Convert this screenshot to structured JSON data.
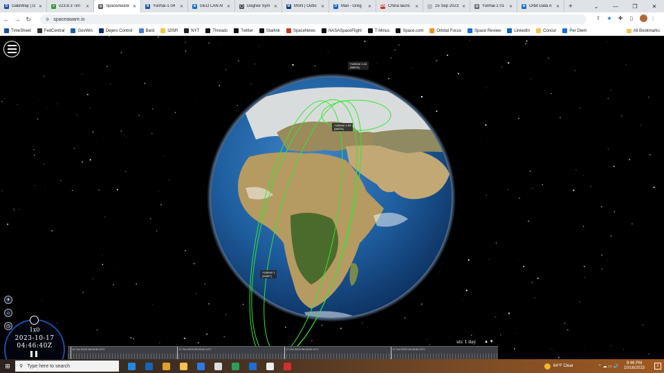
{
  "browser": {
    "tabs": [
      {
        "label": "GateWay | G",
        "color": "#1b4fa8",
        "glyph": "D"
      },
      {
        "label": "v23.8.3 Tim",
        "color": "#3a9b3a",
        "glyph": "≡"
      },
      {
        "label": "SpaceAware",
        "color": "#555555",
        "glyph": "◎",
        "active": true
      },
      {
        "label": "Yunhai-1 04",
        "color": "#2451a5",
        "glyph": "N"
      },
      {
        "label": "GEO LAN Al",
        "color": "#1a6fd0",
        "glyph": "★"
      },
      {
        "label": "Degree Sym",
        "color": "#4a4a4a",
        "glyph": "◯"
      },
      {
        "label": "MSN | Outlo",
        "color": "#0f3d7a",
        "glyph": "M"
      },
      {
        "label": "Mail - Greg",
        "color": "#0a64c8",
        "glyph": "O"
      },
      {
        "label": "China launc",
        "color": "#c0392b",
        "glyph": "SN"
      },
      {
        "label": "25 Sep 2023",
        "color": "#bbbbbb",
        "glyph": ""
      },
      {
        "label": "Yunhai-1 01",
        "color": "#666666",
        "glyph": "◎"
      },
      {
        "label": "Orbit Data A",
        "color": "#1a6fd0",
        "glyph": "★"
      }
    ],
    "url": "spaceaware.io",
    "bookmarks": [
      {
        "label": "TimeSheet",
        "color": "#1b4fa8"
      },
      {
        "label": "FedCentral",
        "color": "#333333"
      },
      {
        "label": "GovWin",
        "color": "#1f5fa9"
      },
      {
        "label": "Dejero Control",
        "color": "#102a6b"
      },
      {
        "label": "Bard",
        "color": "#4a7bd8"
      },
      {
        "label": "I2ISR",
        "color": "#f4c24d"
      },
      {
        "label": "NYT",
        "color": "#222222"
      },
      {
        "label": "Threads",
        "color": "#111111"
      },
      {
        "label": "Twitter",
        "color": "#111111"
      },
      {
        "label": "Starlink",
        "color": "#111111"
      },
      {
        "label": "SpaceNews",
        "color": "#c0392b"
      },
      {
        "label": "NASASpaceFlight",
        "color": "#111111"
      },
      {
        "label": "T-Minus",
        "color": "#111111"
      },
      {
        "label": "Space.com",
        "color": "#111111"
      },
      {
        "label": "Orbital Focus",
        "color": "#f28c28"
      },
      {
        "label": "Space Review",
        "color": "#1a6fd0"
      },
      {
        "label": "LinkedIn",
        "color": "#0a66c2"
      },
      {
        "label": "Concur",
        "color": "#f4c24d"
      },
      {
        "label": "Per Diem",
        "color": "#1a6fd0"
      }
    ],
    "all_bookmarks": "All Bookmarks"
  },
  "viewer": {
    "sat_labels": [
      {
        "name": "YUNHAI 1-04",
        "id": "(58075)"
      },
      {
        "name": "YUNHAI 1-04",
        "id": "(58075)"
      },
      {
        "name": "YUNHAI 1",
        "id": "(41857)"
      }
    ],
    "clock": {
      "speed": "1x0",
      "date": "2023-10-17",
      "time": "04:46:40Z"
    },
    "timeline": {
      "labels": [
        "14 Oct 2023 18:00:00 UTC",
        "17 Oct 2023 00:00:00 UTC",
        "17 Oct 2023 06:00:00 UTC",
        "17 Oct 2023 12:00:00 UTC"
      ],
      "zoom_label": "utc 1 day"
    }
  },
  "taskbar": {
    "search_placeholder": "Type here to search",
    "weather": "64°F  Clear",
    "time": "9:46 PM",
    "date": "10/16/2023",
    "notifications": "2",
    "app_colors": [
      "#1e88e5",
      "#1565c0",
      "#e0a030",
      "#f4c24d",
      "#2c7be5",
      "#dddddd",
      "#2e9e5a",
      "#1b6fd8",
      "#eeeeee",
      "#d32f2f"
    ]
  }
}
